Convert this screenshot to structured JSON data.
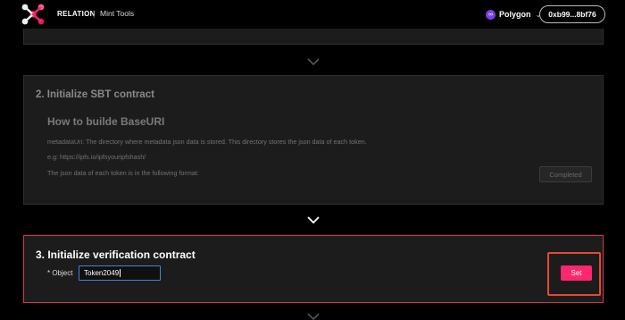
{
  "header": {
    "brand": "RELATION",
    "separator": "|",
    "product": "Mint Tools",
    "network": {
      "label": "Polygon",
      "icon": "polygon-icon"
    },
    "wallet": "0xb99...8bf76"
  },
  "steps": {
    "step2": {
      "title": "2. Initialize SBT contract",
      "subtitle": "How to builde BaseURI",
      "lines": [
        "metadataUri: The directory where metadata json data is stored. This directory stores the json data of each token.",
        "e.g: https://ipfs.io/ipfsyouripfshash/",
        "The json data of each token is in the following format:"
      ],
      "button": "Completed"
    },
    "step3": {
      "title": "3. Initialize verification contract",
      "field_label": "* Object",
      "field_value": "Token2049",
      "button": "Set"
    }
  },
  "colors": {
    "accent": "#ff2670",
    "active_border": "#d8324d",
    "highlight_frame": "#e24a33",
    "input_focus": "#4a7fe0",
    "network": "#7b3fe4"
  }
}
